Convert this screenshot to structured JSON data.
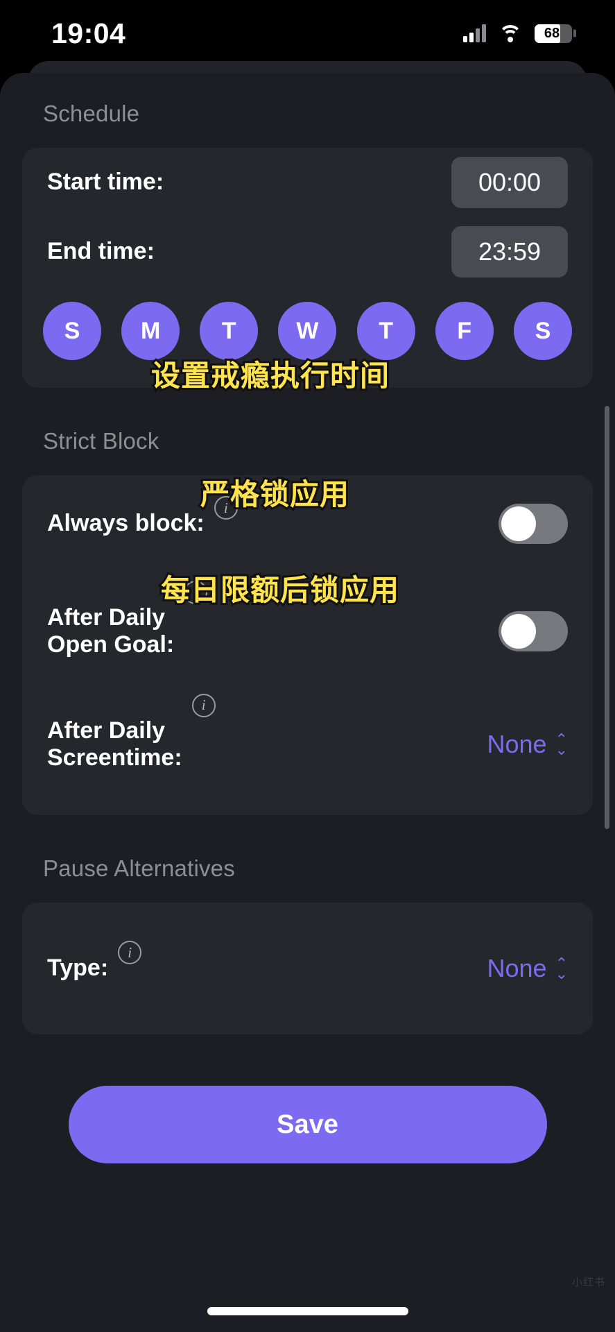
{
  "status_bar": {
    "time": "19:04",
    "battery_percent": "68",
    "signal_icon": "cellular-signal-icon",
    "wifi_icon": "wifi-icon",
    "battery_icon": "battery-icon"
  },
  "sections": {
    "schedule": {
      "title": "Schedule",
      "start_time_label": "Start time:",
      "start_time_value": "00:00",
      "end_time_label": "End time:",
      "end_time_value": "23:59",
      "days": [
        {
          "letter": "S",
          "name": "sunday",
          "selected": true
        },
        {
          "letter": "M",
          "name": "monday",
          "selected": true
        },
        {
          "letter": "T",
          "name": "tuesday",
          "selected": true
        },
        {
          "letter": "W",
          "name": "wednesday",
          "selected": true
        },
        {
          "letter": "T",
          "name": "thursday",
          "selected": true
        },
        {
          "letter": "F",
          "name": "friday",
          "selected": true
        },
        {
          "letter": "S",
          "name": "saturday",
          "selected": true
        }
      ]
    },
    "strict_block": {
      "title": "Strict Block",
      "always_block_label": "Always block:",
      "always_block_state": "off",
      "after_daily_open_goal_label": "After Daily\nOpen Goal:",
      "after_daily_open_goal_state": "off",
      "after_daily_screentime_label": " After Daily\nScreentime:",
      "after_daily_screentime_value": "None"
    },
    "pause_alternatives": {
      "title": "Pause Alternatives",
      "type_label": "Type:",
      "type_value": "None"
    }
  },
  "annotations": [
    {
      "text": "设置戒瘾执行时间",
      "name": "annotation-schedule"
    },
    {
      "text": "严格锁应用",
      "name": "annotation-always-block"
    },
    {
      "text": "每日限额后锁应用",
      "name": "annotation-daily-open-goal"
    }
  ],
  "save_button_label": "Save",
  "info_icon_glyph": "i",
  "dropdown_arrow_up": "⌃",
  "dropdown_arrow_down": "⌄",
  "colors": {
    "accent_purple": "#7c6bf0",
    "annotation_yellow": "#ffe44d",
    "card_bg": "#26272d",
    "sheet_bg": "#1d1e24",
    "chip_bg": "#4a4b52",
    "section_title": "#8e8e93"
  },
  "watermark": "小红书"
}
